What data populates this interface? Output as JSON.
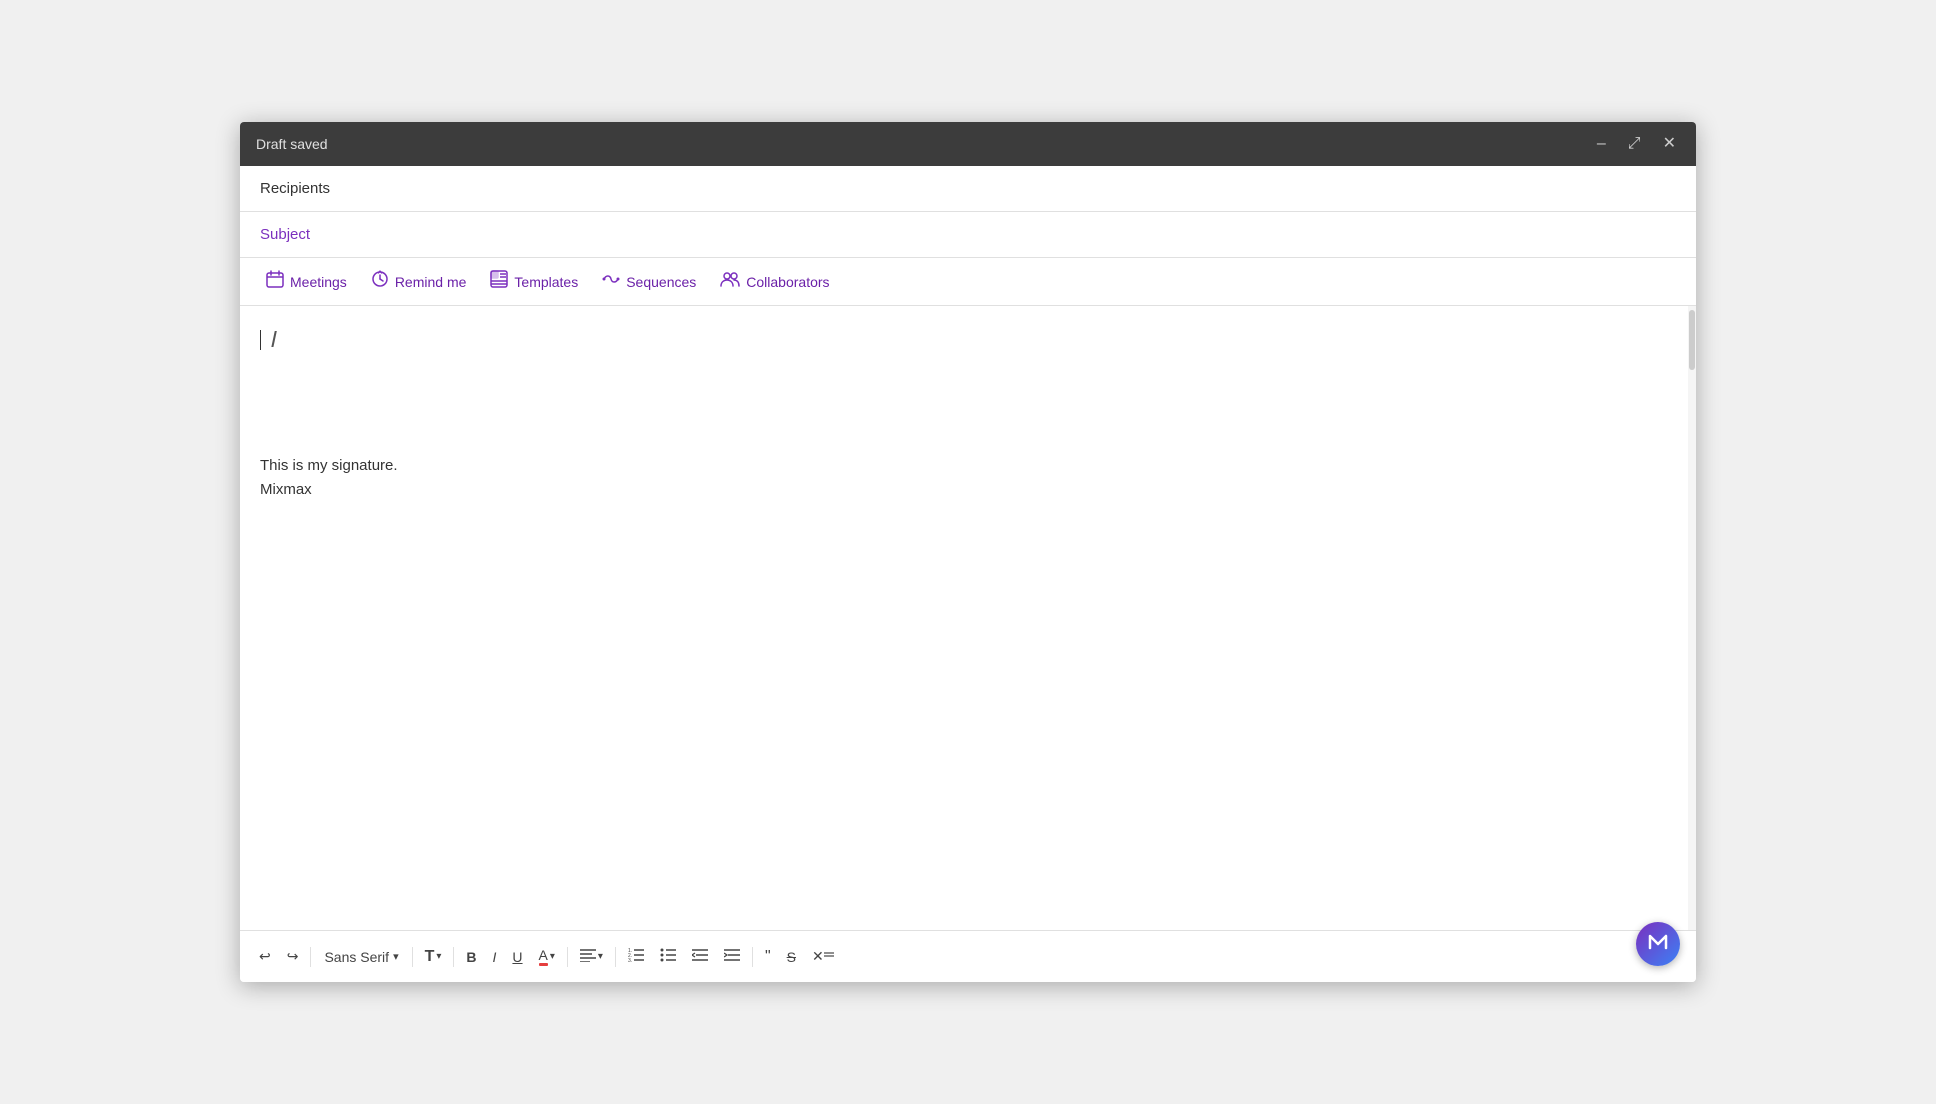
{
  "titlebar": {
    "title": "Draft saved",
    "minimize_label": "–",
    "resize_label": "⤢",
    "close_label": "✕"
  },
  "recipients": {
    "label": "Recipients"
  },
  "subject": {
    "label": "Subject"
  },
  "toolbar": {
    "meetings_label": "Meetings",
    "remind_me_label": "Remind me",
    "templates_label": "Templates",
    "sequences_label": "Sequences",
    "collaborators_label": "Collaborators"
  },
  "body": {
    "signature_line1": "This is my signature.",
    "signature_line2": "Mixmax"
  },
  "formatting": {
    "font_family": "Sans Serif",
    "font_family_chevron": "▾",
    "font_size_chevron": "▾",
    "bold": "B",
    "italic": "I",
    "underline": "U",
    "font_color": "A",
    "align": "≡",
    "ordered_list": "1≡",
    "unordered_list": "•≡",
    "indent_decrease": "⇤",
    "indent_increase": "⇥",
    "blockquote": "❝",
    "strikethrough": "S",
    "clear_format": "✕"
  },
  "fab": {
    "label": "M"
  }
}
